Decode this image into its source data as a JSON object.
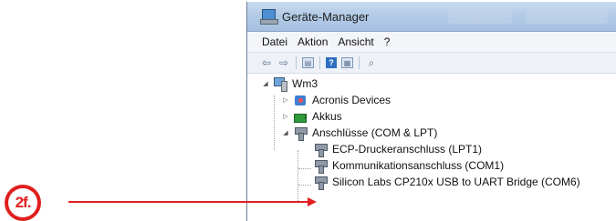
{
  "window": {
    "title": "Geräte-Manager"
  },
  "menu": [
    "Datei",
    "Aktion",
    "Ansicht",
    "?"
  ],
  "tree": {
    "root": "Wm3",
    "items": [
      {
        "label": "Acronis Devices",
        "icon": "acronis-icon",
        "state": "collapsed"
      },
      {
        "label": "Akkus",
        "icon": "battery-icon",
        "state": "collapsed"
      },
      {
        "label": "Anschlüsse (COM & LPT)",
        "icon": "port-icon",
        "state": "expanded",
        "children": [
          "ECP-Druckeranschluss (LPT1)",
          "Kommunikationsanschluss (COM1)",
          "Silicon Labs CP210x USB to UART Bridge (COM6)"
        ]
      }
    ]
  },
  "annotation": {
    "step": "2f.",
    "color": "#e0201f"
  }
}
